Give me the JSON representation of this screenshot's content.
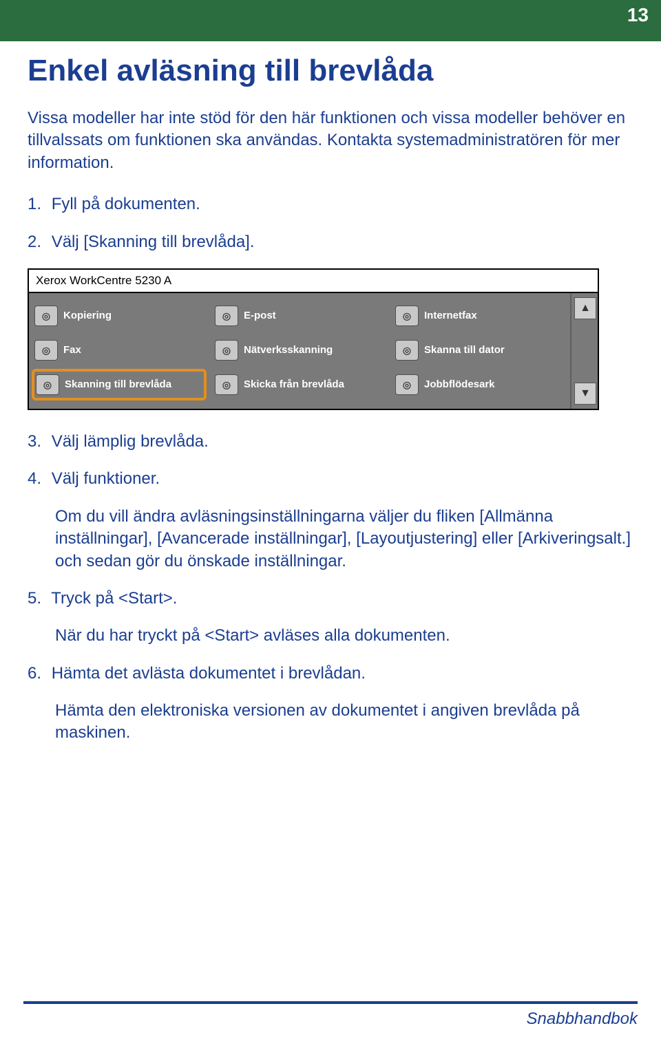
{
  "page_number": "13",
  "title": "Enkel avläsning till brevlåda",
  "intro": "Vissa modeller har inte stöd för den här funktionen och vissa modeller behöver en tillvalssats om funktionen ska användas. Kontakta systemadministratören för mer information.",
  "steps": {
    "s1": {
      "num": "1.",
      "text": "Fyll på dokumenten."
    },
    "s2": {
      "num": "2.",
      "text": "Välj [Skanning till brevlåda]."
    },
    "s3": {
      "num": "3.",
      "text": "Välj lämplig brevlåda."
    },
    "s4": {
      "num": "4.",
      "text": "Välj funktioner."
    },
    "s5": {
      "num": "5.",
      "text": "Tryck på <Start>."
    },
    "s6": {
      "num": "6.",
      "text": "Hämta det avlästa dokumentet i brevlådan."
    }
  },
  "notes": {
    "n4": "Om du vill ändra avläsningsinställningarna väljer du fliken [Allmänna inställningar], [Avancerade inställningar], [Layoutjustering] eller [Arkiveringsalt.] och sedan gör du önskade inställningar.",
    "n5": "När du har tryckt på <Start> avläses alla dokumenten.",
    "n6": "Hämta den elektroniska versionen av dokumentet i angiven brevlåda på maskinen."
  },
  "screen": {
    "device_title": "Xerox WorkCentre 5230 A",
    "items": [
      "Kopiering",
      "E-post",
      "Internetfax",
      "Fax",
      "Nätverksskanning",
      "Skanna till dator",
      "Skanning till brevlåda",
      "Skicka från brevlåda",
      "Jobbflödesark"
    ],
    "highlight_index": 6
  },
  "footer": "Snabbhandbok"
}
